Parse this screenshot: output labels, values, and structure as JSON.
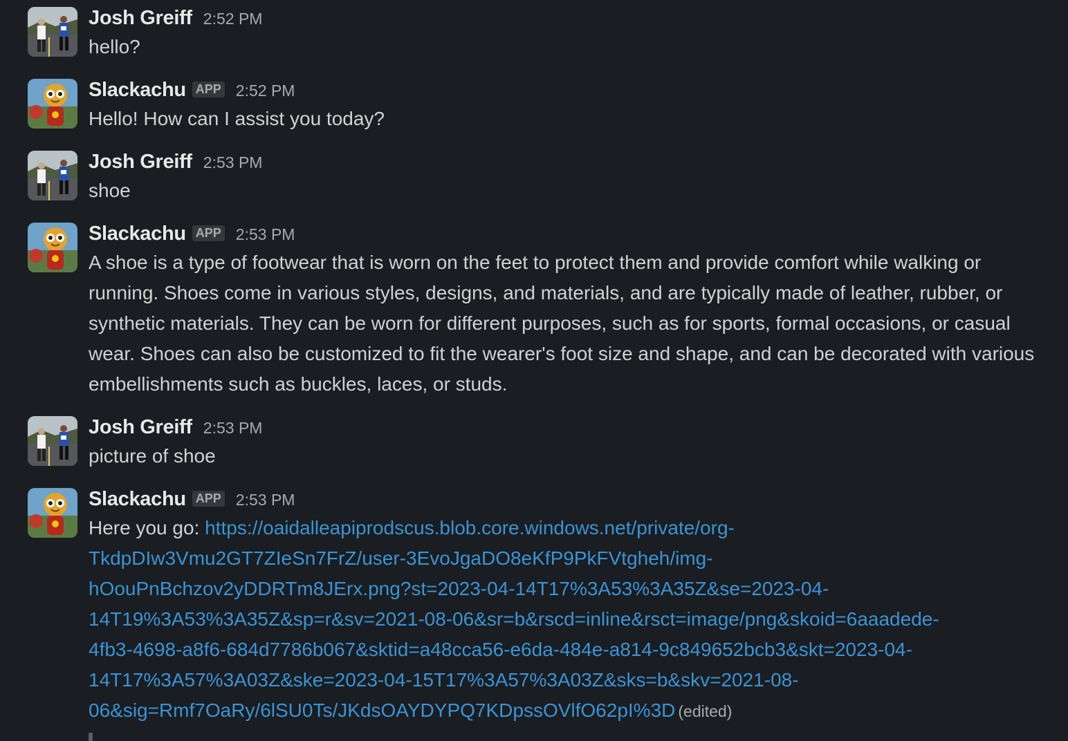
{
  "messages": [
    {
      "sender": "Josh Greiff",
      "avatar_icon": "runner-photo-avatar",
      "time": "2:52 PM",
      "text": "hello?"
    },
    {
      "sender": "Slackachu",
      "badge": "APP",
      "avatar_icon": "bot-character-avatar",
      "time": "2:52 PM",
      "text": "Hello! How can I assist you today?"
    },
    {
      "sender": "Josh Greiff",
      "avatar_icon": "runner-photo-avatar",
      "time": "2:53 PM",
      "text": "shoe"
    },
    {
      "sender": "Slackachu",
      "badge": "APP",
      "avatar_icon": "bot-character-avatar",
      "time": "2:53 PM",
      "text": "A shoe is a type of footwear that is worn on the feet to protect them and provide comfort while walking or running. Shoes come in various styles, designs, and materials, and are typically made of leather, rubber, or synthetic materials. They can be worn for different purposes, such as for sports, formal occasions, or casual wear. Shoes can also be customized to fit the wearer's foot size and shape, and can be decorated with various embellishments such as buckles, laces, or studs."
    },
    {
      "sender": "Josh Greiff",
      "avatar_icon": "runner-photo-avatar",
      "time": "2:53 PM",
      "text": "picture of shoe"
    },
    {
      "sender": "Slackachu",
      "badge": "APP",
      "avatar_icon": "bot-character-avatar",
      "time": "2:53 PM",
      "text_prefix": "Here you go: ",
      "link": "https://oaidalleapiprodscus.blob.core.windows.net/private/org-TkdpDIw3Vmu2GT7ZIeSn7FrZ/user-3EvoJgaDO8eKfP9PkFVtgheh/img-hOouPnBchzov2yDDRTm8JErx.png?st=2023-04-14T17%3A53%3A35Z&se=2023-04-14T19%3A53%3A35Z&sp=r&sv=2021-08-06&sr=b&rscd=inline&rsct=image/png&skoid=6aaadede-4fb3-4698-a8f6-684d7786b067&sktid=a48cca56-e6da-484e-a814-9c849652bcb3&skt=2023-04-14T17%3A57%3A03Z&ske=2023-04-15T17%3A57%3A03Z&sks=b&skv=2021-08-06&sig=Rmf7OaRy/6lSU0Ts/JKdsOAYDYPQ7KDpssOVlfO62pI%3D",
      "link_lines": [
        "https://oaidalleapiprodscus.blob.core.windows.net/private/org-",
        "TkdpDIw3Vmu2GT7ZIeSn7FrZ/user-3EvoJgaDO8eKfP9PkFVtgheh/img-",
        "hOouPnBchzov2yDDRTm8JErx.png?st=2023-04-14T17%3A53%3A35Z&se=2023-04-",
        "14T19%3A53%3A35Z&sp=r&sv=2021-08-06&sr=b&rscd=inline&rsct=image/png&skoid=6aaadede-",
        "4fb3-4698-a8f6-684d7786b067&sktid=a48cca56-e6da-484e-a814-9c849652bcb3&skt=2023-04-",
        "14T17%3A57%3A03Z&ske=2023-04-15T17%3A57%3A03Z&sks=b&skv=2021-08-",
        "06&sig=Rmf7OaRy/6lSU0Ts/JKdsOAYDYPQ7KDpssOVlfO62pI%3D"
      ],
      "edited": "(edited)"
    }
  ],
  "colors": {
    "background": "#1a1d21",
    "text": "#d1d2d3",
    "name": "#e8e8e8",
    "muted": "#a9abad",
    "link": "#3a94d6",
    "badge_bg": "#35373b"
  }
}
